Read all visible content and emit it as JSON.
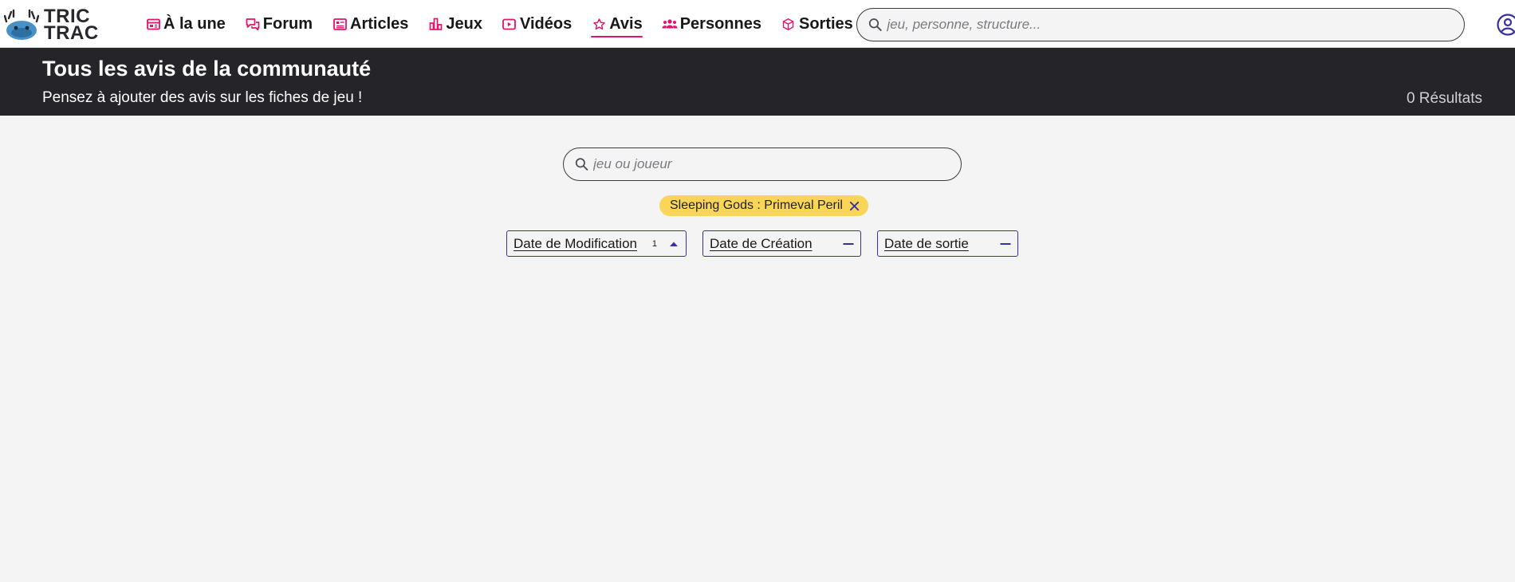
{
  "brand": {
    "line1": "TRIC",
    "line2": "TRAC"
  },
  "nav": {
    "items": [
      {
        "label": "À la une",
        "icon": "newspaper-icon"
      },
      {
        "label": "Forum",
        "icon": "chat-bubbles-icon"
      },
      {
        "label": "Articles",
        "icon": "article-icon"
      },
      {
        "label": "Jeux",
        "icon": "chart-blocks-icon"
      },
      {
        "label": "Vidéos",
        "icon": "play-icon"
      },
      {
        "label": "Avis",
        "icon": "star-icon",
        "active": true
      },
      {
        "label": "Personnes",
        "icon": "people-icon"
      },
      {
        "label": "Sorties",
        "icon": "box-icon"
      }
    ],
    "search_placeholder": "jeu, personne, structure..."
  },
  "banner": {
    "title": "Tous les avis de la communauté",
    "subtitle": "Pensez à ajouter des avis sur les fiches de jeu !",
    "results": "0 Résultats"
  },
  "filters": {
    "search_placeholder": "jeu ou joueur",
    "active_tag": "Sleeping Gods : Primeval Peril",
    "sorts": [
      {
        "label": "Date de Modification",
        "order": "1",
        "state": "ascending"
      },
      {
        "label": "Date de Création",
        "state": "none"
      },
      {
        "label": "Date de sortie",
        "state": "none"
      }
    ]
  },
  "colors": {
    "accent_pink": "#e3126b",
    "accent_indigo": "#3730a3",
    "banner_bg": "#252529",
    "tag_bg": "#fbd558",
    "page_bg": "#f4f4f4"
  }
}
